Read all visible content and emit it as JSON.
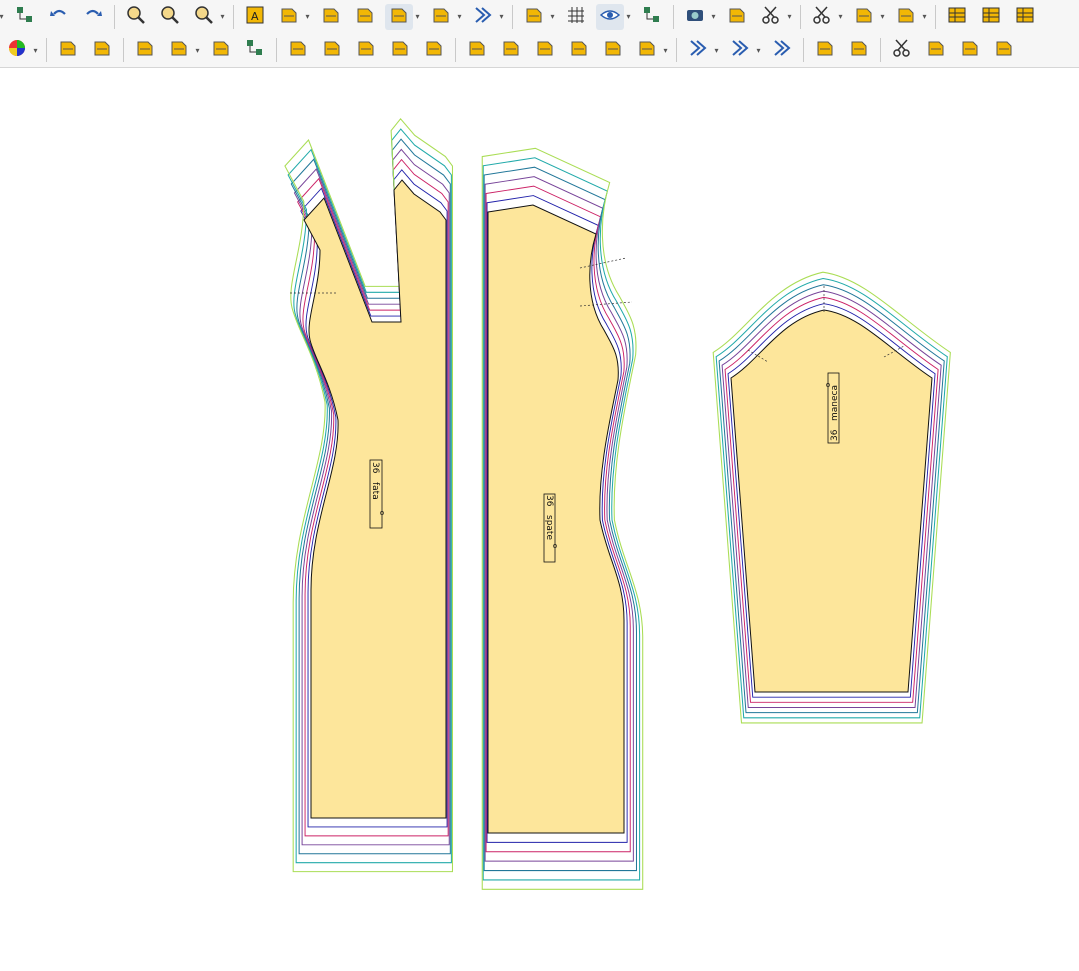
{
  "toolbar_top": [
    {
      "name": "menu-dropdown-icon",
      "type": "dd"
    },
    {
      "name": "tool-options-icon",
      "dd": false
    },
    {
      "name": "undo-icon",
      "dd": false
    },
    {
      "name": "redo-icon",
      "dd": false
    },
    {
      "sep": true
    },
    {
      "name": "zoom-fit-icon",
      "dd": false
    },
    {
      "name": "zoom-selection-icon",
      "dd": false
    },
    {
      "name": "zoom-in-icon",
      "dd": true
    },
    {
      "sep": true
    },
    {
      "name": "text-label-icon",
      "dd": false
    },
    {
      "name": "layout-labels-icon",
      "dd": true
    },
    {
      "name": "piece-up-icon",
      "dd": false
    },
    {
      "name": "piece-stack-icon",
      "dd": false
    },
    {
      "name": "seam-allowance-icon",
      "dd": true,
      "active": true
    },
    {
      "name": "grading-icon",
      "dd": true
    },
    {
      "name": "direction-arrows-icon",
      "dd": true
    },
    {
      "sep": true
    },
    {
      "name": "add-piece-icon",
      "dd": true
    },
    {
      "name": "grid-icon",
      "dd": false
    },
    {
      "name": "eye-visibility-icon",
      "dd": true,
      "active": true
    },
    {
      "name": "node-tool-icon",
      "dd": false
    },
    {
      "sep": true
    },
    {
      "name": "camera-icon",
      "dd": true
    },
    {
      "name": "piece-3d-icon",
      "dd": false
    },
    {
      "name": "cut-check-icon",
      "dd": true
    },
    {
      "sep": true
    },
    {
      "name": "cut-remove-icon",
      "dd": true
    },
    {
      "name": "mark-remove-icon",
      "dd": true
    },
    {
      "name": "mark-check-icon",
      "dd": true
    },
    {
      "sep": true
    },
    {
      "name": "table-icon",
      "dd": false
    },
    {
      "name": "report-icon",
      "dd": false
    },
    {
      "name": "print-icon",
      "dd": false
    }
  ],
  "toolbar_bottom": [
    {
      "name": "color-wheel-icon",
      "dd": true
    },
    {
      "sep": true
    },
    {
      "name": "piece-width-add-icon",
      "dd": false
    },
    {
      "name": "piece-width-add2-icon",
      "dd": false
    },
    {
      "sep": true
    },
    {
      "name": "copy-piece-icon",
      "dd": false
    },
    {
      "name": "mirror-piece-icon",
      "dd": true
    },
    {
      "name": "piece-points-icon",
      "dd": false
    },
    {
      "name": "piece-nodes-icon",
      "dd": false
    },
    {
      "sep": true
    },
    {
      "name": "lock-piece-icon",
      "dd": false
    },
    {
      "name": "select-box-icon",
      "dd": false
    },
    {
      "name": "delete-box-icon",
      "dd": false
    },
    {
      "name": "piece-tag-icon",
      "dd": false
    },
    {
      "name": "piece-edit-icon",
      "dd": false
    },
    {
      "sep": true
    },
    {
      "name": "align-bottom-icon",
      "dd": false
    },
    {
      "name": "align-center-icon",
      "dd": false
    },
    {
      "name": "rotate-icon",
      "dd": false
    },
    {
      "name": "fit-box-icon",
      "dd": false
    },
    {
      "name": "flip-icon",
      "dd": false
    },
    {
      "name": "flag-icon",
      "dd": true
    },
    {
      "sep": true
    },
    {
      "name": "fan-lines-icon",
      "dd": true
    },
    {
      "name": "fan-lines2-icon",
      "dd": true
    },
    {
      "name": "chevrons-icon",
      "dd": false
    },
    {
      "sep": true
    },
    {
      "name": "spread-icon",
      "dd": false
    },
    {
      "name": "polygon-icon",
      "dd": false
    },
    {
      "sep": true
    },
    {
      "name": "scissors-icon",
      "dd": false
    },
    {
      "name": "swap-icon",
      "dd": false
    },
    {
      "name": "resize-icon",
      "dd": false
    },
    {
      "name": "badge-icon",
      "dd": false
    }
  ],
  "pieces": {
    "front": {
      "size": "36",
      "name": "fata"
    },
    "back": {
      "size": "36",
      "name": "spate"
    },
    "sleeve": {
      "size": "36",
      "name": "maneca"
    }
  },
  "colors": {
    "piece_fill": "#fde69b",
    "accent_yellow": "#f2b705",
    "accent_blue": "#2a5db0",
    "grade_lines": [
      "#2222aa",
      "#cc2266",
      "#774499",
      "#227799",
      "#22aaaa",
      "#aadd55"
    ]
  }
}
